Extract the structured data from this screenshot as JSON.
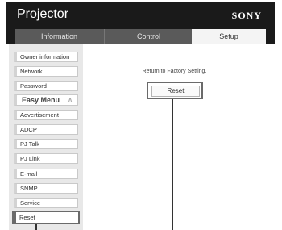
{
  "header": {
    "app_title": "Projector",
    "brand": "SONY"
  },
  "tabs": [
    {
      "label": "Information",
      "active": false
    },
    {
      "label": "Control",
      "active": false
    },
    {
      "label": "Setup",
      "active": true
    }
  ],
  "sidebar": {
    "items": [
      {
        "label": "Owner information"
      },
      {
        "label": "Network"
      },
      {
        "label": "Password"
      },
      {
        "label": "Easy Menu",
        "group": true,
        "icon": "chevron-up-icon"
      },
      {
        "label": "Advertisement"
      },
      {
        "label": "ADCP"
      },
      {
        "label": "PJ Talk"
      },
      {
        "label": "PJ Link"
      },
      {
        "label": "E-mail"
      },
      {
        "label": "SNMP"
      },
      {
        "label": "Service"
      },
      {
        "label": "Reset",
        "selected": true
      }
    ]
  },
  "main": {
    "factory_text": "Return to Factory Setting.",
    "reset_label": "Reset"
  },
  "colors": {
    "header_bg": "#1a1a1a",
    "tab_dark": "#5a5a5a",
    "tab_active": "#f4f4f4",
    "sidebar_bg": "#e8e8e8",
    "highlight_border": "#6a6a6a"
  }
}
